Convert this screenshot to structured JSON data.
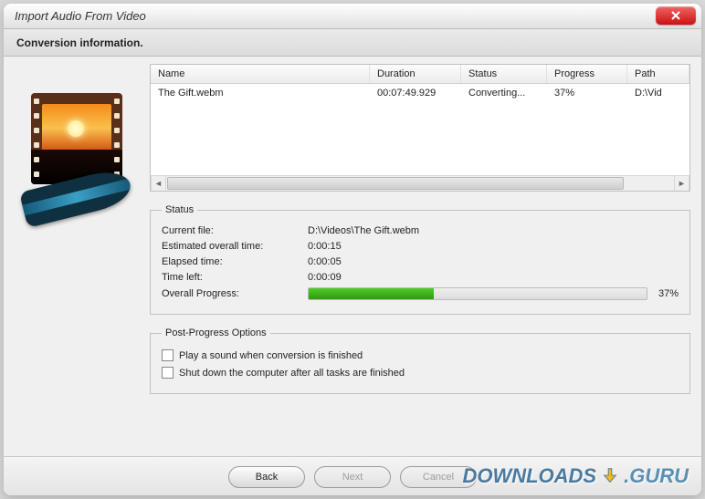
{
  "window": {
    "title": "Import Audio From Video"
  },
  "header": {
    "subtitle": "Conversion information."
  },
  "table": {
    "columns": {
      "name": "Name",
      "duration": "Duration",
      "status": "Status",
      "progress": "Progress",
      "path": "Path"
    },
    "row": {
      "name": "The Gift.webm",
      "duration": "00:07:49.929",
      "status": "Converting...",
      "progress": "37%",
      "path": "D:\\Vid"
    }
  },
  "status": {
    "legend": "Status",
    "current_file_label": "Current file:",
    "current_file": "D:\\Videos\\The Gift.webm",
    "eta_label": "Estimated overall time:",
    "eta": "0:00:15",
    "elapsed_label": "Elapsed time:",
    "elapsed": "0:00:05",
    "left_label": "Time left:",
    "left": "0:00:09",
    "overall_label": "Overall Progress:",
    "overall_pct_text": "37%",
    "overall_pct": 37
  },
  "post": {
    "legend": "Post-Progress Options",
    "play_sound": "Play a sound when conversion is finished",
    "shutdown": "Shut down the computer after all tasks are finished"
  },
  "footer": {
    "back": "Back",
    "next": "Next",
    "cancel": "Cancel"
  },
  "watermark": {
    "a": "DOWNLOADS",
    "b": ".GURU"
  }
}
